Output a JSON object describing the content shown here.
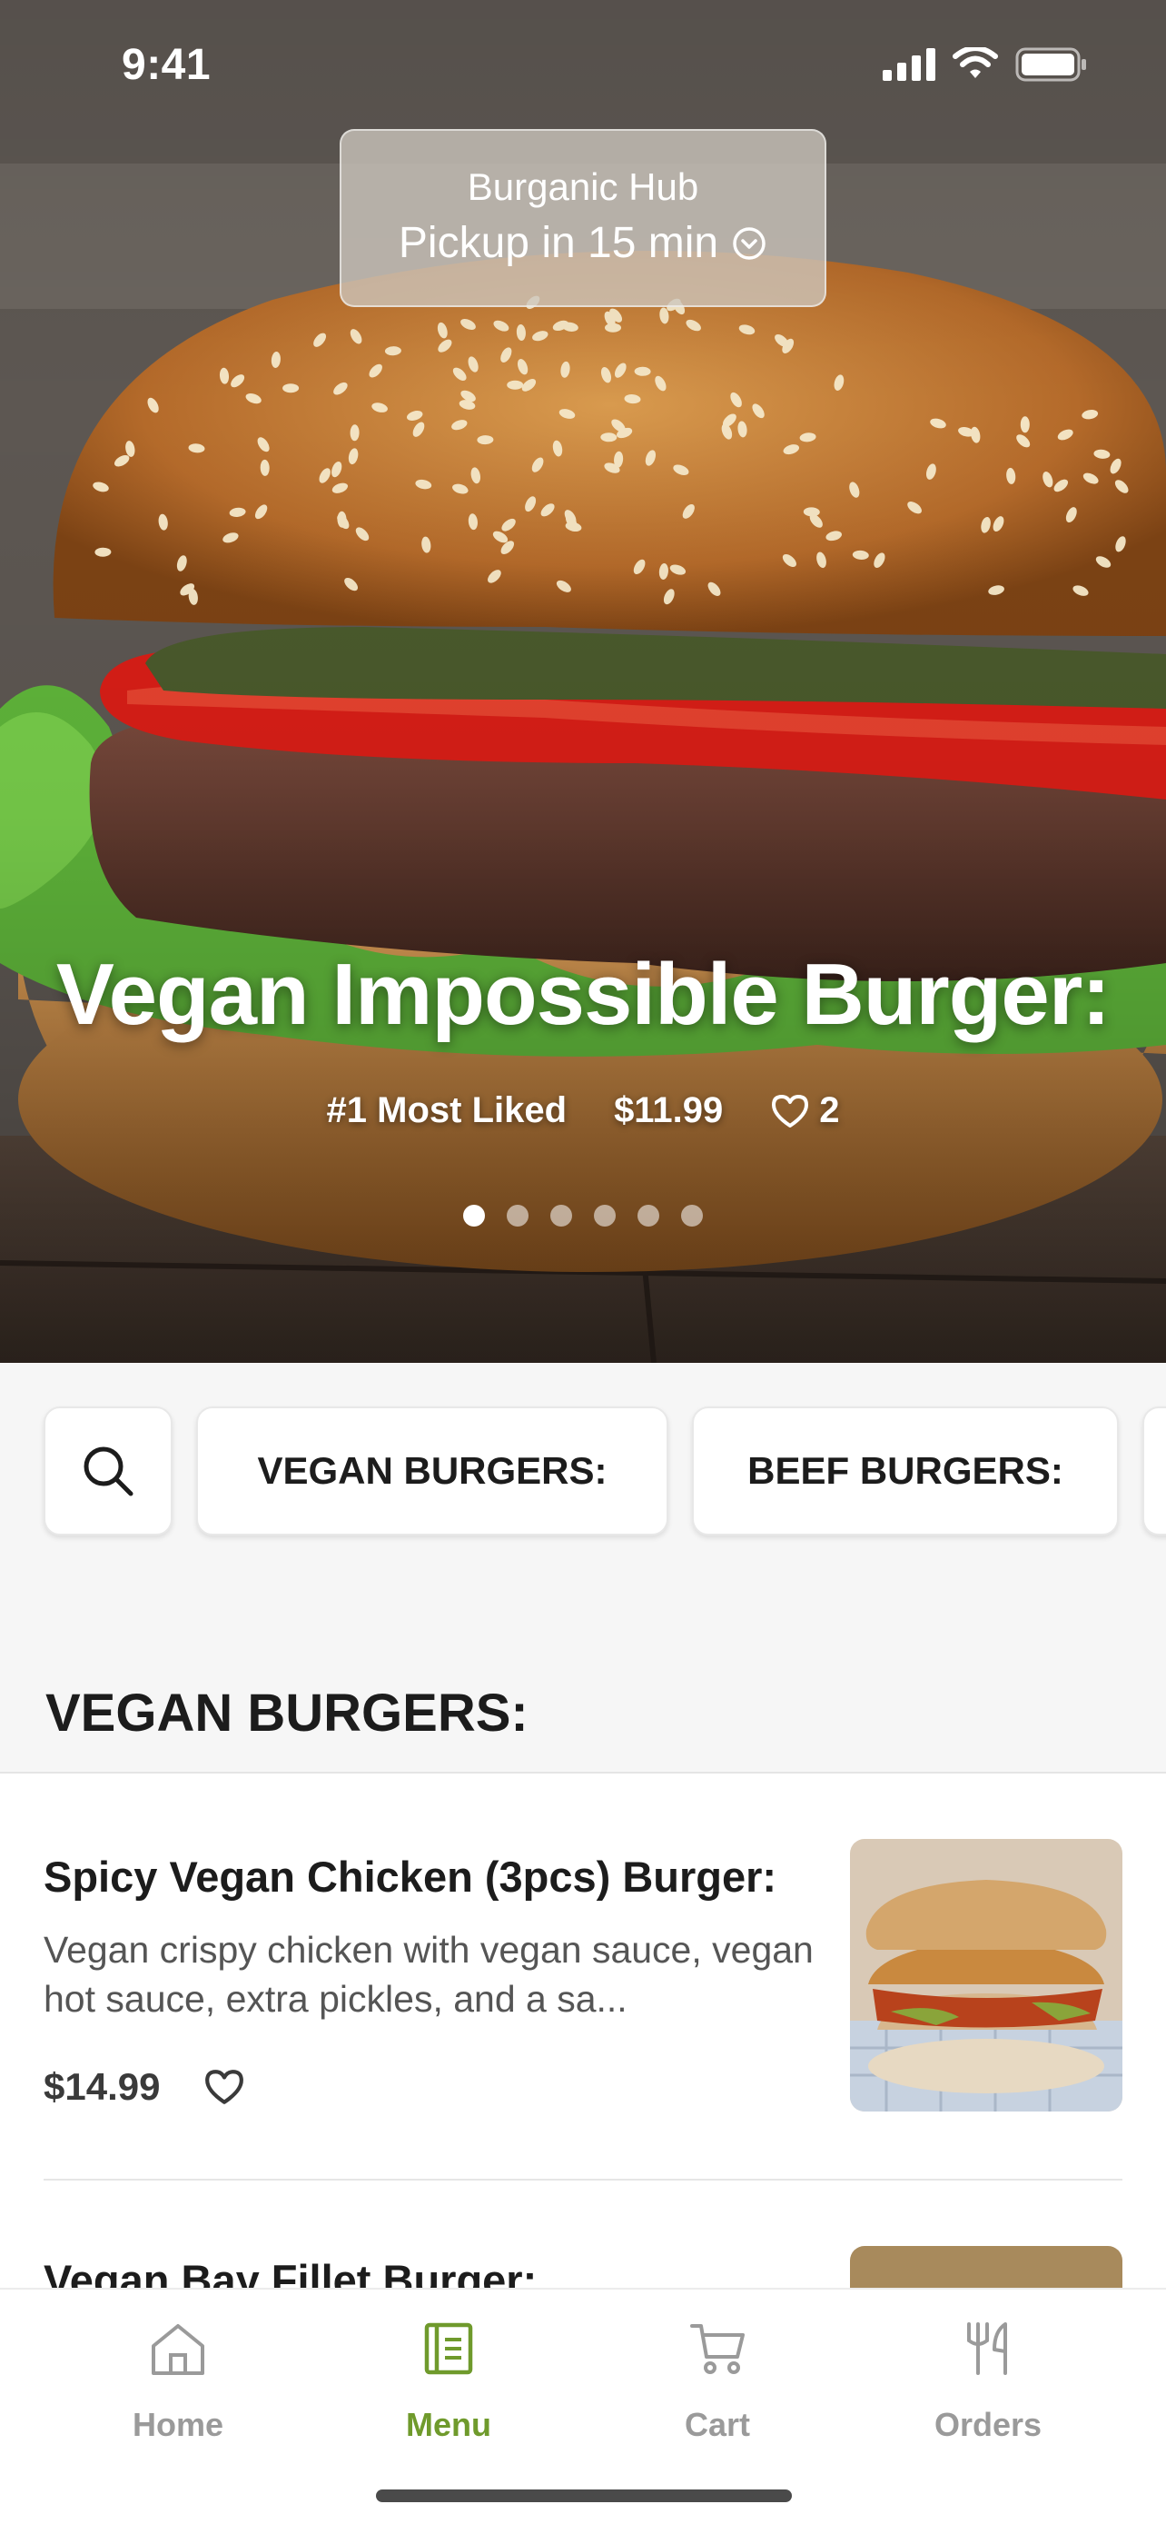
{
  "status_bar": {
    "time": "9:41"
  },
  "location": {
    "store": "Burganic Hub",
    "eta": "Pickup in 15 min"
  },
  "hero": {
    "title": "Vegan Impossible Burger:",
    "tag": "#1 Most Liked",
    "price": "$11.99",
    "likes": "2",
    "slides_total": 6,
    "slide_active": 1
  },
  "chips": [
    "VEGAN BURGERS:",
    "BEEF BURGERS:"
  ],
  "section": {
    "title": "VEGAN BURGERS:"
  },
  "items": [
    {
      "name": "Spicy Vegan Chicken (3pcs) Burger:",
      "description": "Vegan crispy chicken with vegan sauce, vegan hot sauce, extra pickles, and a sa...",
      "price": "$14.99"
    },
    {
      "name": "Vegan Bay Fillet Burger:"
    }
  ],
  "tabs": [
    {
      "label": "Home",
      "icon": "home-icon"
    },
    {
      "label": "Menu",
      "icon": "menu-book-icon"
    },
    {
      "label": "Cart",
      "icon": "cart-icon"
    },
    {
      "label": "Orders",
      "icon": "fork-knife-icon"
    }
  ],
  "colors": {
    "accent": "#6f9a2c",
    "inactive": "#9a9a9a",
    "text": "#1c1c1c"
  }
}
